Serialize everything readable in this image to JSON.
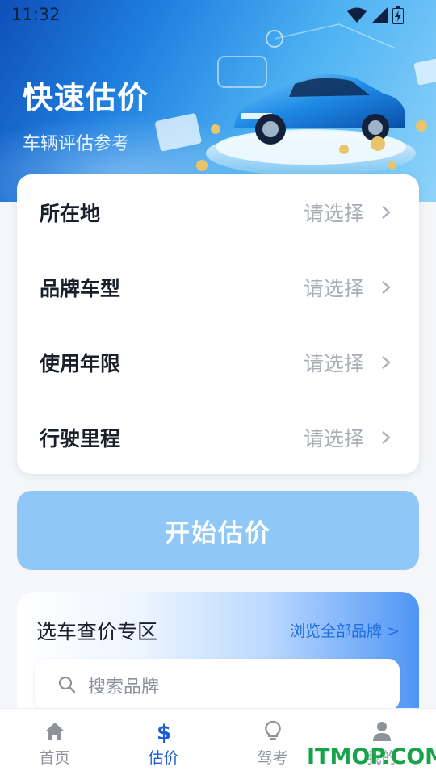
{
  "status_bar": {
    "time": "11:32"
  },
  "hero": {
    "title": "快速估价",
    "subtitle": "车辆评估参考"
  },
  "form": {
    "rows": [
      {
        "label": "所在地",
        "value": "请选择"
      },
      {
        "label": "品牌车型",
        "value": "请选择"
      },
      {
        "label": "使用年限",
        "value": "请选择"
      },
      {
        "label": "行驶里程",
        "value": "请选择"
      }
    ]
  },
  "start_button": {
    "label": "开始估价"
  },
  "brand_section": {
    "title": "选车查价专区",
    "link": "浏览全部品牌 >",
    "search_placeholder": "搜索品牌"
  },
  "bottom_nav": {
    "items": [
      {
        "label": "首页",
        "icon": "home-icon",
        "active": false
      },
      {
        "label": "估价",
        "icon": "dollar-icon",
        "active": true
      },
      {
        "label": "驾考",
        "icon": "bulb-icon",
        "active": false
      },
      {
        "label": "我的",
        "icon": "person-icon",
        "active": false
      }
    ]
  },
  "watermark": {
    "text": "ITMOP.COM"
  },
  "colors": {
    "accent": "#1a5fd6",
    "start_button_bg": "#8fc8f6",
    "placeholder": "#a9adb5",
    "watermark": "#17a34a"
  }
}
